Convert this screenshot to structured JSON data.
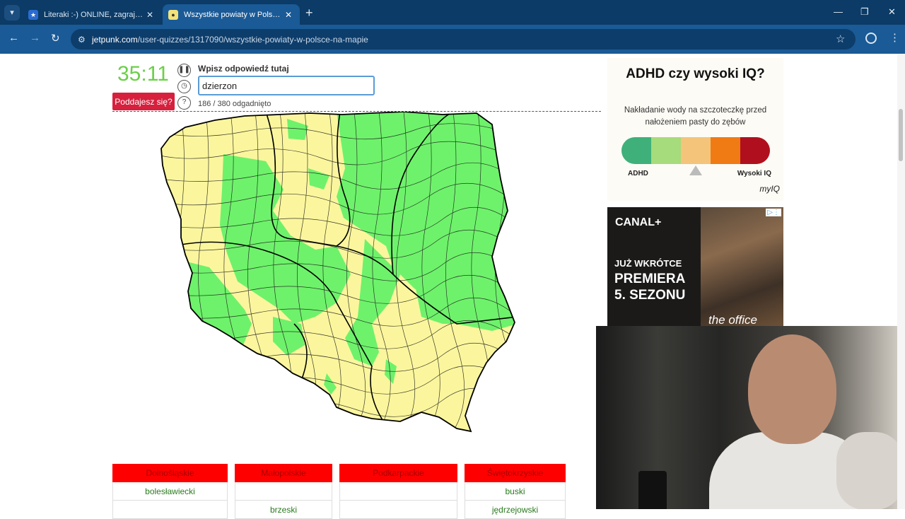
{
  "browser": {
    "tabs": [
      {
        "title": "Literaki :-) ONLINE, zagraj - Kur",
        "active": false
      },
      {
        "title": "Wszystkie powiaty w Polsce na",
        "active": true
      }
    ],
    "url_host": "jetpunk.com",
    "url_path": "/user-quizzes/1317090/wszystkie-powiaty-w-polsce-na-mapie"
  },
  "quiz": {
    "timer": "35:11",
    "give_up_label": "Poddajesz się?",
    "prompt": "Wpisz odpowiedź tutaj",
    "answer_value": "dzierzon",
    "progress": "186 / 380 odgadnięto",
    "map_colors": {
      "guessed": "#6ef26b",
      "missing": "#fbf69d",
      "border": "#111111"
    }
  },
  "ad_adhd": {
    "title": "ADHD czy wysoki IQ?",
    "subtitle": "Nakładanie wody na szczoteczkę przed nałożeniem pasty do zębów",
    "scale_colors": [
      "#3fb07a",
      "#a6dc7b",
      "#f3c47a",
      "#f07a14",
      "#b0101e"
    ],
    "left_label": "ADHD",
    "right_label": "Wysoki IQ",
    "brand": "myIQ"
  },
  "ad_canal": {
    "brand": "CANAL+",
    "line1": "JUŻ WKRÓTCE",
    "line2": "PREMIERA",
    "line3": "5. SEZONU",
    "show": "the office"
  },
  "results": [
    {
      "region": "Dolnośląskie",
      "items": [
        "bolesławiecki",
        ""
      ]
    },
    {
      "region": "Małopolskie",
      "items": [
        "",
        "brzeski"
      ]
    },
    {
      "region": "Podkarpackie",
      "items": [
        "",
        ""
      ]
    },
    {
      "region": "Świętokrzyskie",
      "items": [
        "buski",
        "jędrzejowski"
      ]
    }
  ]
}
